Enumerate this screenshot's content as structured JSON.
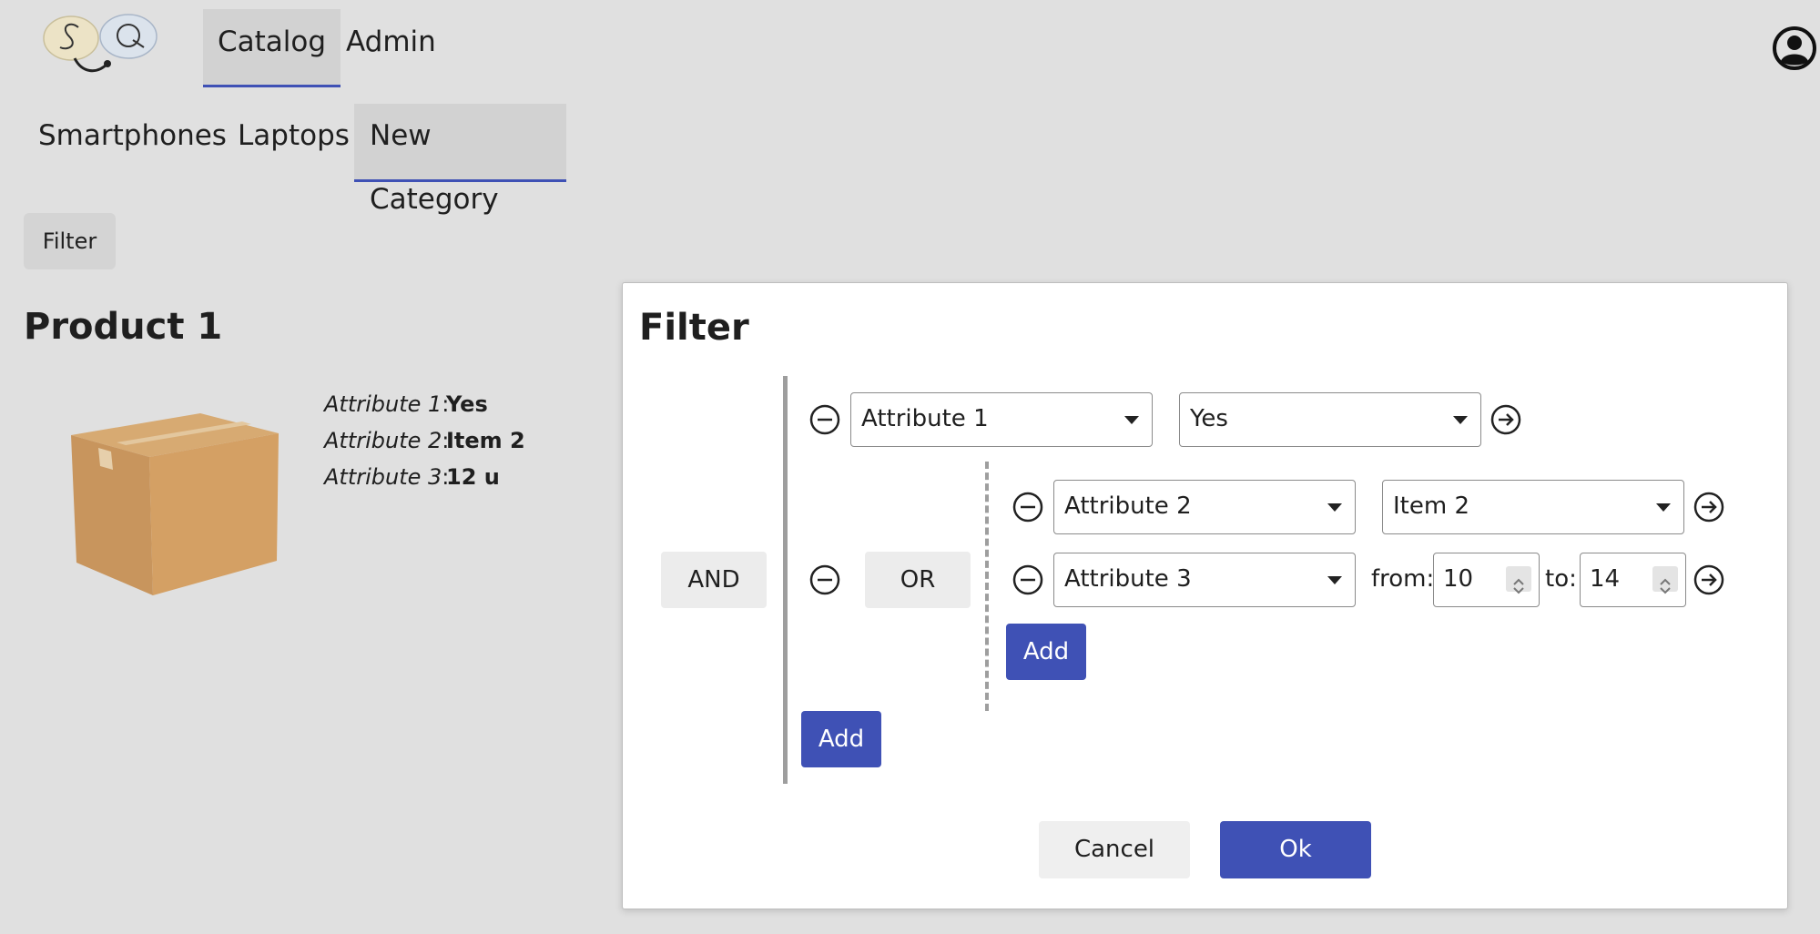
{
  "app": {
    "logo": {
      "letters": "S Q"
    },
    "nav": [
      {
        "label": "Catalog",
        "active": true
      },
      {
        "label": "Admin",
        "active": false
      }
    ],
    "user_icon": "user-circle-icon"
  },
  "categories": [
    {
      "label": "Smartphones",
      "active": false
    },
    {
      "label": "Laptops",
      "active": false
    },
    {
      "label": "New Category",
      "active": true
    }
  ],
  "toolbar": {
    "filter_label": "Filter"
  },
  "product": {
    "title": "Product 1",
    "image": "cardboard-box",
    "attributes": [
      {
        "name": "Attribute 1",
        "value": "Yes"
      },
      {
        "name": "Attribute 2",
        "value": "Item 2"
      },
      {
        "name": "Attribute 3",
        "value": "12 u"
      }
    ]
  },
  "dialog": {
    "title": "Filter",
    "root_operator": "AND",
    "condition1": {
      "attribute": "Attribute 1",
      "value": "Yes"
    },
    "subgroup": {
      "operator": "OR",
      "condition1": {
        "attribute": "Attribute 2",
        "value": "Item 2"
      },
      "condition2": {
        "attribute": "Attribute 3",
        "from_label": "from:",
        "from_value": "10",
        "to_label": "to:",
        "to_value": "14"
      },
      "add_label": "Add"
    },
    "add_label": "Add",
    "cancel_label": "Cancel",
    "ok_label": "Ok"
  },
  "colors": {
    "primary": "#3f51b5",
    "background": "#e0e0e0",
    "tab_active": "#d2d2d2"
  }
}
